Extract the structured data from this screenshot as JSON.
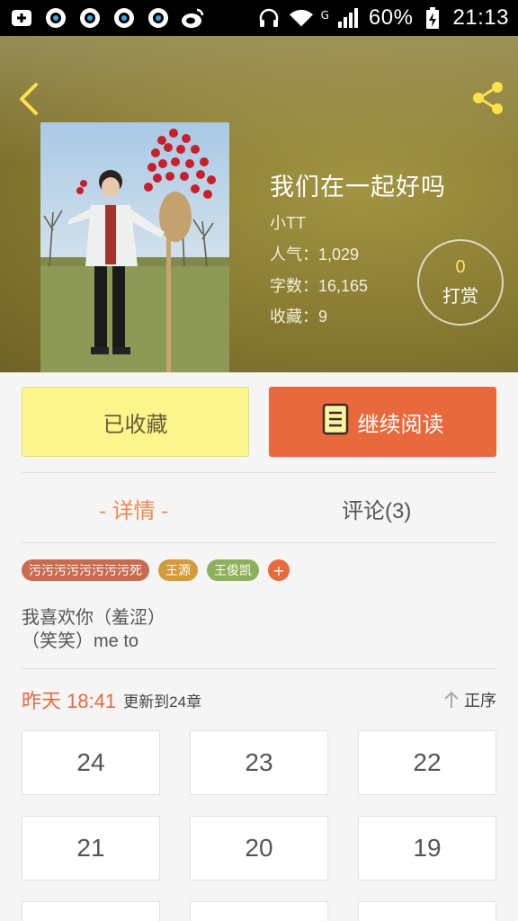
{
  "status_bar": {
    "battery": "60%",
    "network": "G",
    "time": "21:13"
  },
  "book": {
    "title": "我们在一起好吗",
    "author": "小TT",
    "popularity": "人气：1,029",
    "word_count": "字数：16,165",
    "favorites": "收藏：9"
  },
  "reward": {
    "count": "0",
    "label": "打赏"
  },
  "actions": {
    "favorited_label": "已收藏",
    "continue_label": "继续阅读"
  },
  "tabs": {
    "detail": "- 详情 -",
    "comments": "评论(3)"
  },
  "tags": [
    {
      "label": "污污污污污污污污死",
      "color": "#c96b4f"
    },
    {
      "label": "王源",
      "color": "#d49a3a"
    },
    {
      "label": "王俊凯",
      "color": "#8fb05a"
    }
  ],
  "tag_add": "+",
  "description": {
    "line1": "我喜欢你（羞涩）",
    "line2": "（笑笑）me to"
  },
  "update": {
    "time": "昨天 18:41",
    "text": "更新到24章",
    "sort_label": "正序"
  },
  "chapters": [
    "24",
    "23",
    "22",
    "21",
    "20",
    "19"
  ],
  "colors": {
    "accent": "#e8693c",
    "fav_button": "#fbf58b",
    "hero": "#8c7e34"
  }
}
